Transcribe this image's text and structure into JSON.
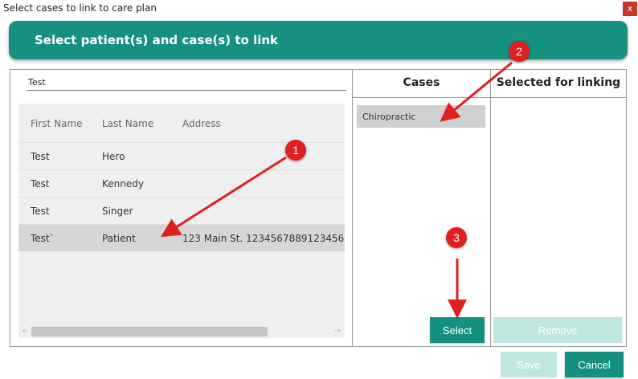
{
  "window": {
    "title": "Select cases to link to care plan",
    "close_label": "x"
  },
  "header": {
    "title": "Select patient(s) and case(s) to link"
  },
  "search": {
    "value": "Test"
  },
  "patients": {
    "columns": [
      "First Name",
      "Last Name",
      "Address"
    ],
    "rows": [
      {
        "first": "Test",
        "last": "Hero",
        "address": ""
      },
      {
        "first": "Test",
        "last": "Kennedy",
        "address": ""
      },
      {
        "first": "Test",
        "last": "Singer",
        "address": ""
      },
      {
        "first": "Test`",
        "last": "Patient",
        "address": "123 Main St. 1234567889123456"
      }
    ],
    "selected_index": 3
  },
  "cases": {
    "title": "Cases",
    "items": [
      "Chiropractic"
    ]
  },
  "selected_for_linking": {
    "title": "Selected for linking"
  },
  "buttons": {
    "select": "Select",
    "remove": "Remove",
    "save": "Save",
    "cancel": "Cancel"
  },
  "annotations": [
    "1",
    "2",
    "3"
  ],
  "icons": {
    "scroll_left": "arrow-left-icon",
    "scroll_right": "arrow-right-icon"
  },
  "colors": {
    "accent": "#16917f",
    "annotation": "#e02020",
    "disabled": "#bfe6df"
  }
}
